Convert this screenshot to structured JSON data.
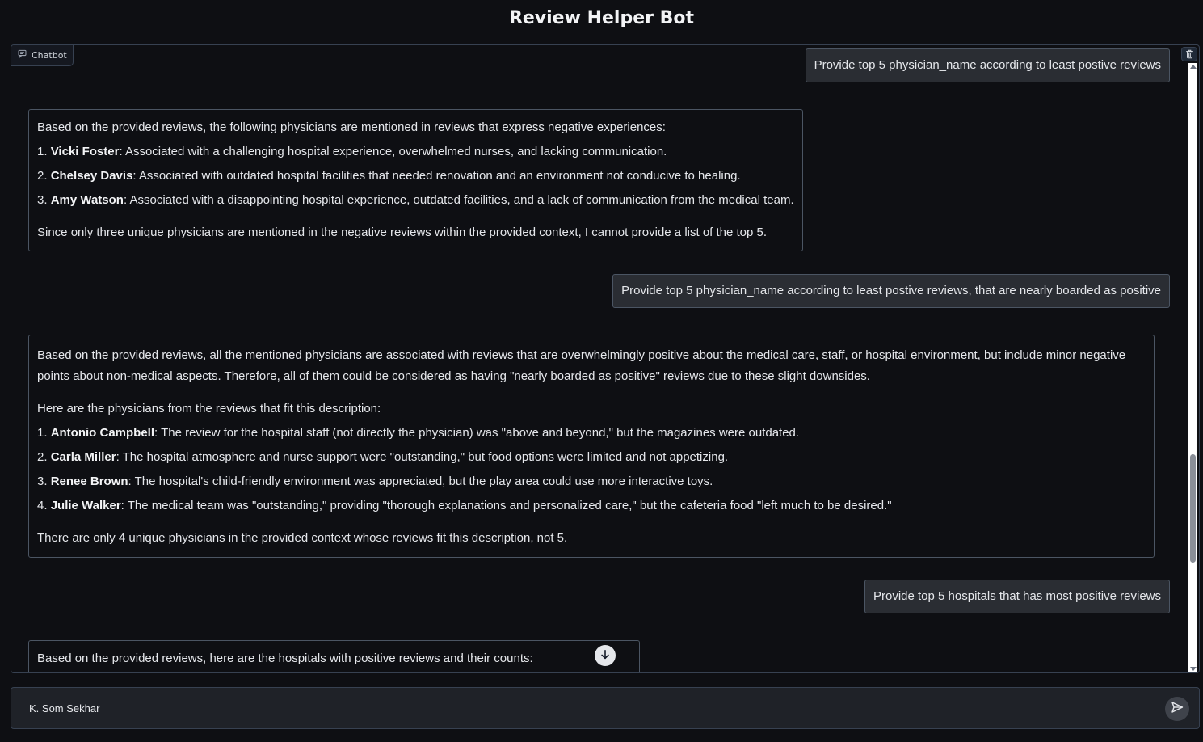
{
  "app": {
    "title": "Review Helper Bot"
  },
  "chatbot": {
    "label": "Chatbot",
    "messages": [
      {
        "role": "user",
        "text": "Provide top 5 physician_name according to least postive reviews"
      },
      {
        "role": "bot",
        "intro": "Based on the provided reviews, the following physicians are mentioned in reviews that express negative experiences:",
        "items": [
          {
            "num": "1. ",
            "name": "Vicki Foster",
            "text": ": Associated with a challenging hospital experience, overwhelmed nurses, and lacking communication."
          },
          {
            "num": "2. ",
            "name": "Chelsey Davis",
            "text": ": Associated with outdated hospital facilities that needed renovation and an environment not conducive to healing."
          },
          {
            "num": "3. ",
            "name": "Amy Watson",
            "text": ": Associated with a disappointing hospital experience, outdated facilities, and a lack of communication from the medical team."
          }
        ],
        "outro": "Since only three unique physicians are mentioned in the negative reviews within the provided context, I cannot provide a list of the top 5."
      },
      {
        "role": "user",
        "text": "Provide top 5 physician_name according to least postive reviews, that are nearly boarded as positive"
      },
      {
        "role": "bot",
        "intro": "Based on the provided reviews, all the mentioned physicians are associated with reviews that are overwhelmingly positive about the medical care, staff, or hospital environment, but include minor negative points about non-medical aspects. Therefore, all of them could be considered as having \"nearly boarded as positive\" reviews due to these slight downsides.",
        "sub": "Here are the physicians from the reviews that fit this description:",
        "items": [
          {
            "num": "1. ",
            "name": "Antonio Campbell",
            "text": ": The review for the hospital staff (not directly the physician) was \"above and beyond,\" but the magazines were outdated."
          },
          {
            "num": "2. ",
            "name": "Carla Miller",
            "text": ": The hospital atmosphere and nurse support were \"outstanding,\" but food options were limited and not appetizing."
          },
          {
            "num": "3. ",
            "name": "Renee Brown",
            "text": ": The hospital's child-friendly environment was appreciated, but the play area could use more interactive toys."
          },
          {
            "num": "4. ",
            "name": "Julie Walker",
            "text": ": The medical team was \"outstanding,\" providing \"thorough explanations and personalized care,\" but the cafeteria food \"left much to be desired.\""
          }
        ],
        "outro": "There are only 4 unique physicians in the provided context whose reviews fit this description, not 5."
      },
      {
        "role": "user",
        "text": "Provide top 5 hospitals that has most positive reviews"
      },
      {
        "role": "bot",
        "intro": "Based on the provided reviews, here are the hospitals with positive reviews and their counts:"
      }
    ]
  },
  "input": {
    "value": "K. Som Sekhar",
    "placeholder": ""
  },
  "icons": {
    "chatbot_label": "chat-icon",
    "clear": "trash-icon",
    "scroll_down": "arrow-down-icon",
    "send": "send-icon"
  }
}
